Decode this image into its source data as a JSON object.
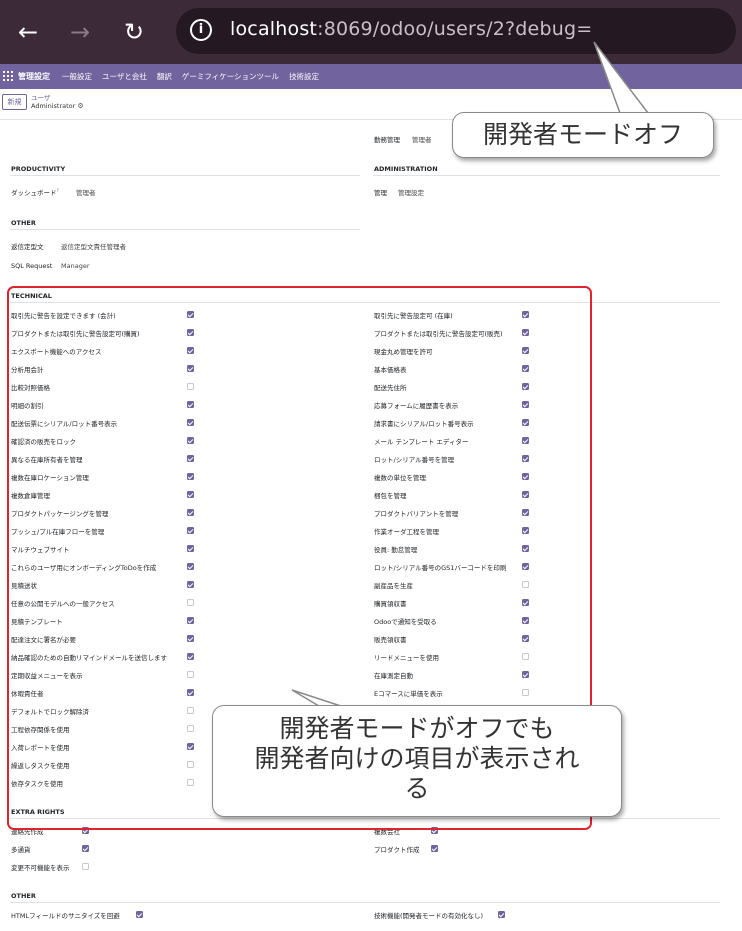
{
  "browser": {
    "back_icon": "back-arrow-icon",
    "forward_icon": "forward-arrow-icon",
    "reload_icon": "reload-icon",
    "info_icon": "info-icon",
    "url_host": "localhost",
    "url_path": ":8069/odoo/users/2?debug="
  },
  "menubar": {
    "apps_icon": "apps-grid-icon",
    "brand": "管理設定",
    "items": [
      "一般設定",
      "ユーザと会社",
      "翻訳",
      "ゲーミフィケーションツール",
      "技術設定"
    ]
  },
  "control_panel": {
    "new_label": "新規",
    "breadcrumb": "ユーザ",
    "record_name": "Administrator",
    "gear_icon": "gear-icon"
  },
  "top_partial": {
    "label": "勤務管理",
    "value": "管理者"
  },
  "sections": {
    "productivity": {
      "title": "PRODUCTIVITY",
      "rows": [
        {
          "label": "ダッシュボード",
          "value": "管理者"
        }
      ]
    },
    "administration": {
      "title": "ADMINISTRATION",
      "rows": [
        {
          "label": "管理",
          "value": "管理設定"
        }
      ]
    },
    "other_top": {
      "title": "OTHER",
      "rows": [
        {
          "label": "返信定型文",
          "value": "返信定型文責任管理者"
        },
        {
          "label": "SQL Request",
          "value": "Manager"
        }
      ]
    },
    "technical": {
      "title": "TECHNICAL",
      "left": [
        {
          "label": "取引先に警告を設定できます (会計)",
          "checked": true
        },
        {
          "label": "プロダクトまたは取引先に警告設定可(購買)",
          "checked": true
        },
        {
          "label": "エクスポート機能へのアクセス",
          "checked": true
        },
        {
          "label": "分析用会計",
          "checked": true
        },
        {
          "label": "比較対照価格",
          "checked": false
        },
        {
          "label": "明細の割引",
          "checked": true
        },
        {
          "label": "配送伝票にシリアル/ロット番号表示",
          "checked": true
        },
        {
          "label": "確認済の販売をロック",
          "checked": true
        },
        {
          "label": "異なる在庫所有者を管理",
          "checked": true
        },
        {
          "label": "複数在庫ロケーション管理",
          "checked": true
        },
        {
          "label": "複数倉庫管理",
          "checked": true
        },
        {
          "label": "プロダクトパッケージングを管理",
          "checked": true
        },
        {
          "label": "プッシュ/プル在庫フローを管理",
          "checked": true
        },
        {
          "label": "マルチウェブサイト",
          "checked": true
        },
        {
          "label": "これらのユーザ用にオンボーディングToDoを作成",
          "checked": true
        },
        {
          "label": "見積送状",
          "checked": true
        },
        {
          "label": "任意の公開モデルへの一般アクセス",
          "checked": false
        },
        {
          "label": "見積テンプレート",
          "checked": true
        },
        {
          "label": "配達注文に署名が必要",
          "checked": true
        },
        {
          "label": "納品確認のための自動リマインドメールを送信します",
          "checked": true
        },
        {
          "label": "定期収益メニューを表示",
          "checked": false
        },
        {
          "label": "休暇責任者",
          "checked": true
        },
        {
          "label": "デフォルトでロック解除済",
          "checked": false
        },
        {
          "label": "工程依存関係を使用",
          "checked": false
        },
        {
          "label": "入荷レポートを使用",
          "checked": true
        },
        {
          "label": "繰返しタスクを使用",
          "checked": false
        },
        {
          "label": "依存タスクを使用",
          "checked": false
        }
      ],
      "right": [
        {
          "label": "取引先に警告設定可 (在庫)",
          "checked": true
        },
        {
          "label": "プロダクトまたは取引先に警告設定可(販売)",
          "checked": true
        },
        {
          "label": "現金丸め管理を許可",
          "checked": true
        },
        {
          "label": "基本価格表",
          "checked": true
        },
        {
          "label": "配送先住所",
          "checked": true
        },
        {
          "label": "応募フォームに履歴書を表示",
          "checked": true
        },
        {
          "label": "請求書にシリアル/ロット番号表示",
          "checked": true
        },
        {
          "label": "メール テンプレート エディター",
          "checked": true
        },
        {
          "label": "ロット/シリアル番号を管理",
          "checked": true
        },
        {
          "label": "複数の単位を管理",
          "checked": true
        },
        {
          "label": "梱包を管理",
          "checked": true
        },
        {
          "label": "プロダクトバリアントを管理",
          "checked": true
        },
        {
          "label": "作業オーダ工程を管理",
          "checked": true
        },
        {
          "label": "役員: 勤怠管理",
          "checked": true
        },
        {
          "label": "ロット/シリアル番号のGS1バーコードを印刷",
          "checked": true
        },
        {
          "label": "副産品を生産",
          "checked": false
        },
        {
          "label": "購買領収書",
          "checked": true
        },
        {
          "label": "Odooで通知を受取る",
          "checked": true
        },
        {
          "label": "販売領収書",
          "checked": true
        },
        {
          "label": "リードメニューを使用",
          "checked": false
        },
        {
          "label": "在庫測定自動",
          "checked": true
        },
        {
          "label": "Eコマースに単価を表示",
          "checked": false
        }
      ]
    },
    "extra_rights": {
      "title": "EXTRA RIGHTS",
      "left": [
        {
          "label": "連絡先作成",
          "checked": true
        },
        {
          "label": "多通貨",
          "checked": true
        },
        {
          "label": "変更不可機能を表示",
          "checked": false
        }
      ],
      "right": [
        {
          "label": "複数会社",
          "checked": true
        },
        {
          "label": "プロダクト作成",
          "checked": true
        }
      ]
    },
    "other_bottom": {
      "title": "OTHER",
      "left": [
        {
          "label": "HTMLフィールドのサニタイズを回避",
          "checked": true
        }
      ],
      "right": [
        {
          "label": "技術機能(開発者モードの有効化なし)",
          "checked": true
        }
      ]
    }
  },
  "annotations": {
    "top_callout": "開発者モードオフ",
    "bottom_callout_line1": "開発者モードがオフでも",
    "bottom_callout_line2": "開発者向けの項目が表示され",
    "bottom_callout_line3": "る"
  },
  "colors": {
    "browser_bar": "#3c2a39",
    "url_pill": "#241923",
    "menubar": "#71639e",
    "checkbox_on": "#71639e",
    "highlight_box": "#e0242e"
  }
}
